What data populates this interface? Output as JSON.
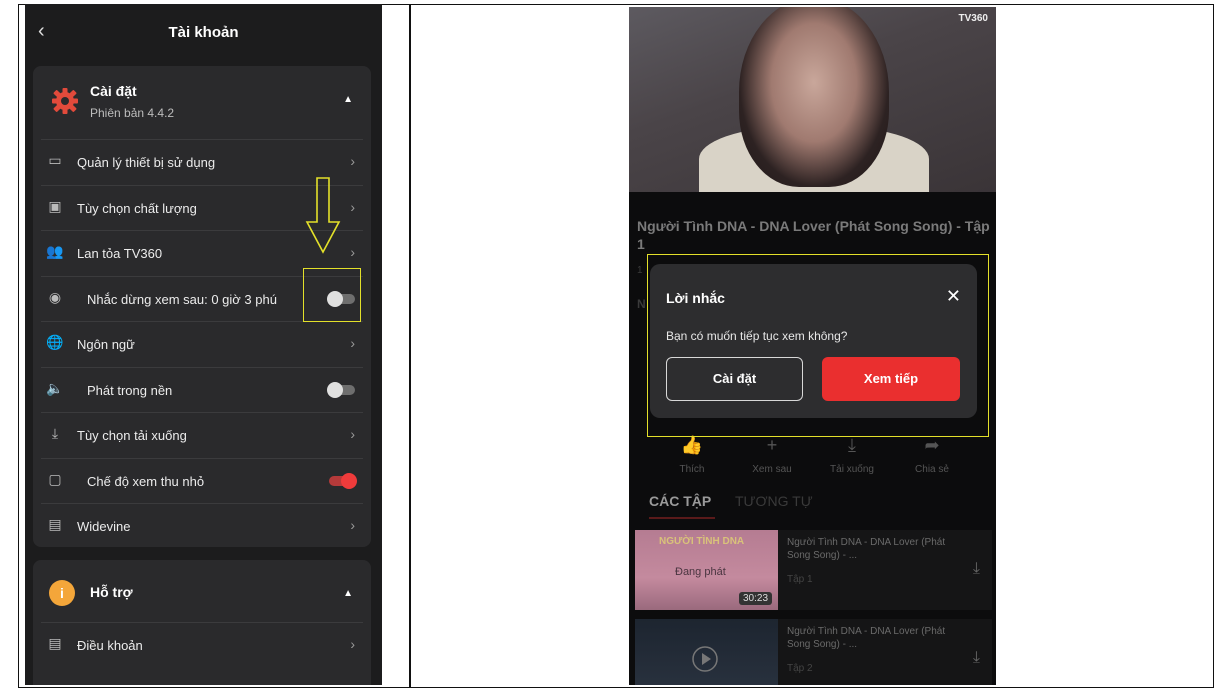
{
  "left": {
    "header": {
      "back": "‹",
      "title": "Tài khoản"
    },
    "settings": {
      "title": "Cài đặt",
      "version": "Phiên bản 4.4.2",
      "caret": "▲",
      "items": [
        {
          "label": "Quản lý thiết bị sử dụng",
          "icon": "device-icon",
          "control": "chevron"
        },
        {
          "label": "Tùy chọn chất lượng",
          "icon": "quality-icon",
          "control": "chevron"
        },
        {
          "label": "Lan tỏa TV360",
          "icon": "share-people-icon",
          "control": "chevron"
        },
        {
          "label": "Nhắc dừng xem sau: 0 giờ 3 phú",
          "icon": "timer-icon",
          "control": "toggle",
          "on": false
        },
        {
          "label": "Ngôn ngữ",
          "icon": "globe-icon",
          "control": "chevron"
        },
        {
          "label": "Phát trong nền",
          "icon": "speaker-icon",
          "control": "toggle",
          "on": false
        },
        {
          "label": "Tùy chọn tải xuống",
          "icon": "download-icon",
          "control": "chevron"
        },
        {
          "label": "Chế độ xem thu nhỏ",
          "icon": "pip-icon",
          "control": "toggle",
          "on": true
        },
        {
          "label": "Widevine",
          "icon": "doc-icon",
          "control": "chevron"
        }
      ]
    },
    "support": {
      "title": "Hỗ trợ",
      "icon_text": "i",
      "caret": "▲",
      "items": [
        {
          "label": "Điều khoản",
          "icon": "doc-icon",
          "control": "chevron"
        }
      ]
    },
    "chevron": "›",
    "highlight_color": "#e3e02a"
  },
  "right": {
    "logo": "TV360",
    "show_title": "Người Tình DNA - DNA Lover (Phát Song Song) - Tập 1",
    "actions": [
      {
        "icon": "like-icon",
        "glyph": "👍",
        "label": "Thích"
      },
      {
        "icon": "plus-icon",
        "glyph": "+",
        "label": "Xem sau"
      },
      {
        "icon": "download-icon",
        "glyph": "⤓",
        "label": "Tải xuống"
      },
      {
        "icon": "share-icon",
        "glyph": "➦",
        "label": "Chia sẻ"
      }
    ],
    "tabs": [
      "CÁC TẬP",
      "TƯƠNG TỰ"
    ],
    "episodes": [
      {
        "title": "Người Tình DNA - DNA Lover (Phát Song Song) - ...",
        "ep": "Tập 1",
        "duration": "30:23",
        "thumb_title": "NGƯỜI TÌNH DNA",
        "thumb_mid": "Đang phát"
      },
      {
        "title": "Người Tình DNA - DNA Lover (Phát Song Song) - ...",
        "ep": "Tập 2"
      }
    ],
    "dialog": {
      "title": "Lời nhắc",
      "close": "✕",
      "message": "Bạn có muốn tiếp tục xem không?",
      "secondary": "Cài đặt",
      "primary": "Xem tiếp"
    },
    "accent": "#ea2f2f"
  }
}
